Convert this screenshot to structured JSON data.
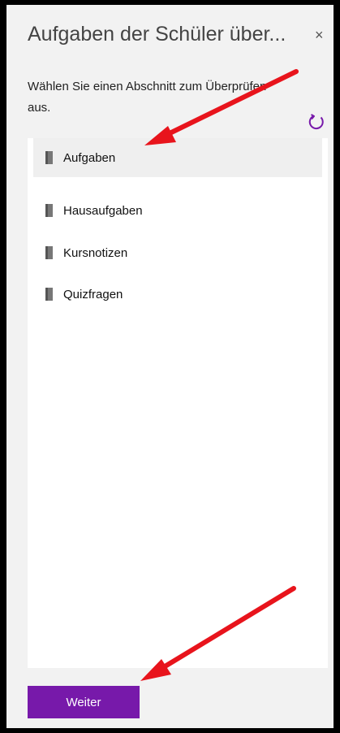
{
  "dialog": {
    "title": "Aufgaben der Schüler über...",
    "close_glyph": "×",
    "description": "Wählen Sie einen Abschnitt zum Überprüfen aus.",
    "refresh_icon": "refresh-icon"
  },
  "sections": {
    "items": [
      {
        "label": "Aufgaben",
        "selected": true,
        "icon": "section-tab-icon"
      },
      {
        "label": "Hausaufgaben",
        "selected": false,
        "icon": "section-tab-icon"
      },
      {
        "label": "Kursnotizen",
        "selected": false,
        "icon": "section-tab-icon"
      },
      {
        "label": "Quizfragen",
        "selected": false,
        "icon": "section-tab-icon"
      }
    ]
  },
  "footer": {
    "next_label": "Weiter"
  },
  "colors": {
    "accent": "#7719aa",
    "annotation_arrow": "#e8141c",
    "panel_background": "#f2f2f2",
    "selected_row": "#efefef"
  }
}
